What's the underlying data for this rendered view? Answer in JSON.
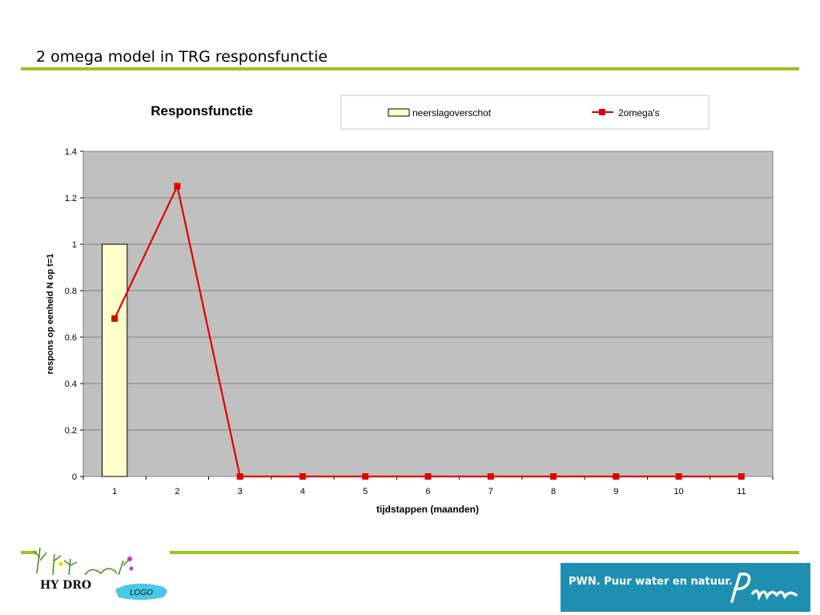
{
  "slide": {
    "title": "2 omega model in TRG  responsfunctie"
  },
  "colors": {
    "accent_rule": "#9bc31f",
    "plot_background": "#c0c0c0",
    "bar_fill": "#ffffcc",
    "line_color": "#e00000",
    "pwn_blue": "#1e8fb0"
  },
  "chart_data": {
    "type": "bar",
    "title": "Responsfunctie",
    "xlabel": "tijdstappen (maanden)",
    "ylabel": "respons op eenheid N op t=1",
    "categories": [
      "1",
      "2",
      "3",
      "4",
      "5",
      "6",
      "7",
      "8",
      "9",
      "10",
      "11"
    ],
    "yticks": [
      "0",
      "0.2",
      "0.4",
      "0.6",
      "0.8",
      "1",
      "1.2",
      "1.4"
    ],
    "ylim": [
      0,
      1.4
    ],
    "grid": true,
    "legend_position": "top-right",
    "series": [
      {
        "name": "neerslagoverschot",
        "kind": "bar",
        "values": [
          1,
          0,
          0,
          0,
          0,
          0,
          0,
          0,
          0,
          0,
          0
        ]
      },
      {
        "name": "2omega's",
        "kind": "line",
        "values": [
          0.68,
          1.25,
          0,
          0,
          0,
          0,
          0,
          0,
          0,
          0,
          0
        ]
      }
    ]
  },
  "logos": {
    "hydro_text": "HY DRO",
    "hydro_badge": "LOGO",
    "pwn_text": "PWN. Puur water en natuur."
  }
}
